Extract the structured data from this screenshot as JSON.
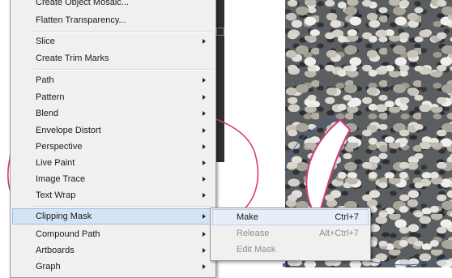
{
  "menu": {
    "items": [
      {
        "label": "Create Object Mosaic...",
        "has_submenu": false
      },
      {
        "label": "Flatten Transparency...",
        "has_submenu": false
      },
      {
        "label": "Slice",
        "has_submenu": true
      },
      {
        "label": "Create Trim Marks",
        "has_submenu": false
      },
      {
        "label": "Path",
        "has_submenu": true
      },
      {
        "label": "Pattern",
        "has_submenu": true
      },
      {
        "label": "Blend",
        "has_submenu": true
      },
      {
        "label": "Envelope Distort",
        "has_submenu": true
      },
      {
        "label": "Perspective",
        "has_submenu": true
      },
      {
        "label": "Live Paint",
        "has_submenu": true
      },
      {
        "label": "Image Trace",
        "has_submenu": true
      },
      {
        "label": "Text Wrap",
        "has_submenu": true
      },
      {
        "label": "Clipping Mask",
        "has_submenu": true,
        "highlighted": true
      },
      {
        "label": "Compound Path",
        "has_submenu": true
      },
      {
        "label": "Artboards",
        "has_submenu": true
      },
      {
        "label": "Graph",
        "has_submenu": true
      }
    ]
  },
  "submenu": {
    "items": [
      {
        "label": "Make",
        "shortcut": "Ctrl+7",
        "enabled": true
      },
      {
        "label": "Release",
        "shortcut": "Alt+Ctrl+7",
        "enabled": false
      },
      {
        "label": "Edit Mask",
        "shortcut": "",
        "enabled": false
      }
    ]
  },
  "colors": {
    "menu_bg": "#f0f0f0",
    "highlight": "#d5e4f5",
    "shape_stroke": "#d63b7a",
    "selection_stroke": "#3a5fa8"
  }
}
